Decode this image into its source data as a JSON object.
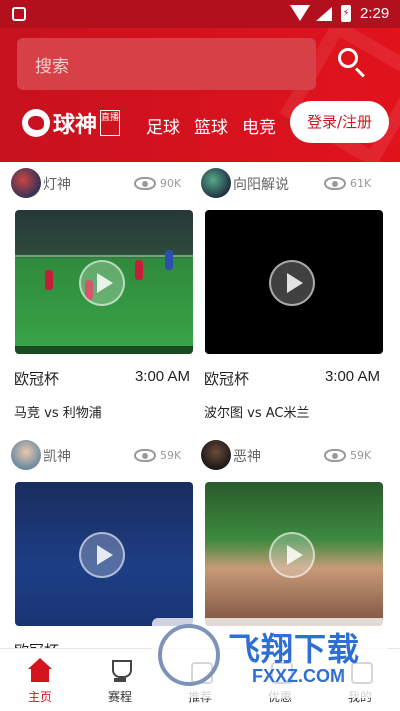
{
  "status_bar": {
    "time": "2:29"
  },
  "header": {
    "search_placeholder": "搜索",
    "logo_name": "球神",
    "logo_tag": "直播",
    "nav_tabs": [
      "足球",
      "篮球",
      "电竞"
    ],
    "login_label": "登录/注册"
  },
  "colors": {
    "brand": "#d3151f",
    "header": "#c8121f"
  },
  "cards": [
    {
      "author": "灯神",
      "views": "90K",
      "competition": "欧冠杯",
      "time": "3:00 AM",
      "match": "马竞 vs 利物浦"
    },
    {
      "author": "向阳解说",
      "views": "61K",
      "competition": "欧冠杯",
      "time": "3:00 AM",
      "match": "波尔图 vs AC米兰"
    },
    {
      "author": "凯神",
      "views": "59K",
      "competition": "欧冠杯",
      "time": "",
      "match": ""
    },
    {
      "author": "恶神",
      "views": "59K",
      "competition": "",
      "time": "",
      "match": ""
    }
  ],
  "tabbar": {
    "items": [
      {
        "label": "主页",
        "icon": "home-icon"
      },
      {
        "label": "赛程",
        "icon": "trophy-icon"
      },
      {
        "label": "推荐",
        "icon": "recommend-icon"
      },
      {
        "label": "优惠",
        "icon": "offer-icon"
      },
      {
        "label": "我的",
        "icon": "profile-icon"
      }
    ]
  },
  "watermark": {
    "title": "飞翔下载",
    "url": "FXXZ.COM"
  }
}
